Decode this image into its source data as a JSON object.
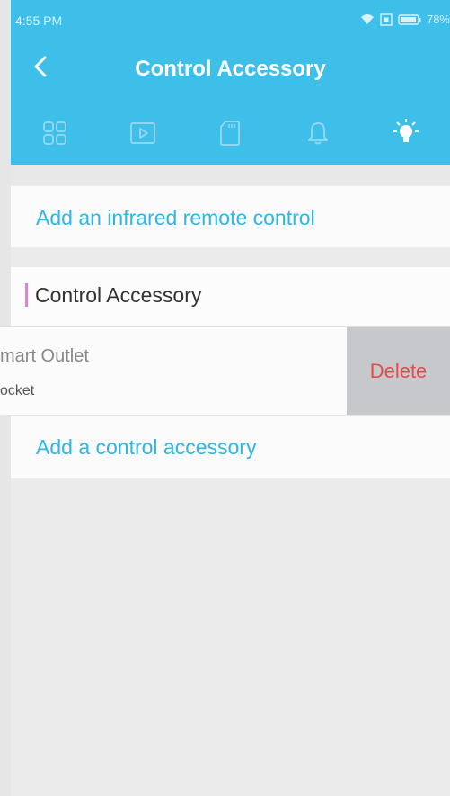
{
  "status_bar": {
    "time": "4:55 PM",
    "battery_percent": "78%"
  },
  "header": {
    "title": "Control Accessory",
    "tabs": [
      {
        "icon": "grid-icon",
        "active": false
      },
      {
        "icon": "play-video-icon",
        "active": false
      },
      {
        "icon": "sd-card-icon",
        "active": false
      },
      {
        "icon": "bell-icon",
        "active": false
      },
      {
        "icon": "light-bulb-icon",
        "active": true
      }
    ]
  },
  "infrared": {
    "label": "Add an infrared remote control"
  },
  "section": {
    "title": "Control Accessory"
  },
  "accessories": [
    {
      "name": "mart Outlet",
      "type": "ocket",
      "delete_label": "Delete"
    }
  ],
  "add_accessory": {
    "label": "Add a control accessory"
  },
  "colors": {
    "header_bg": "#3dbfe9",
    "link": "#2eb6e6",
    "delete_text": "#e54b4b",
    "section_marker": "#d08fc4"
  }
}
